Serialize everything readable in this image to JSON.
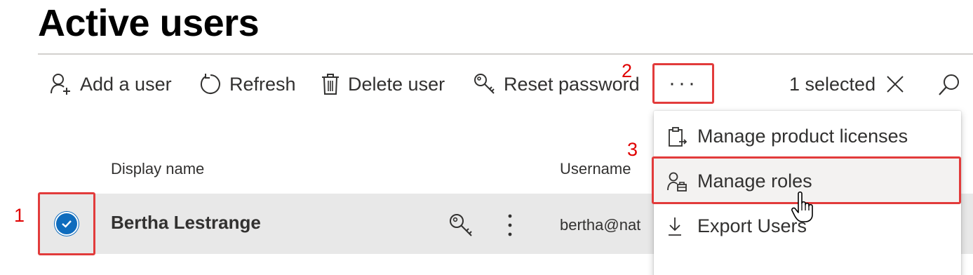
{
  "page": {
    "title": "Active users"
  },
  "toolbar": {
    "add_user_label": "Add a user",
    "refresh_label": "Refresh",
    "delete_user_label": "Delete user",
    "reset_password_label": "Reset password",
    "more_label": "···",
    "selected_text": "1 selected"
  },
  "annotations": {
    "step1": "1",
    "step2": "2",
    "step3": "3",
    "color": "#e23b3b"
  },
  "table": {
    "columns": [
      "Display name",
      "Username"
    ],
    "rows": [
      {
        "display_name": "Bertha Lestrange",
        "username": "bertha@nat",
        "selected": true
      }
    ]
  },
  "more_menu": {
    "items": [
      {
        "label": "Manage product licenses",
        "icon": "clipboard-license-icon"
      },
      {
        "label": "Manage roles",
        "icon": "person-roles-icon",
        "highlighted": true
      },
      {
        "label": "Export Users",
        "icon": "download-icon"
      }
    ]
  },
  "colors": {
    "accent": "#0f6cbd",
    "row_selected_bg": "#e8e8e8",
    "annotation_red": "#e23b3b"
  }
}
